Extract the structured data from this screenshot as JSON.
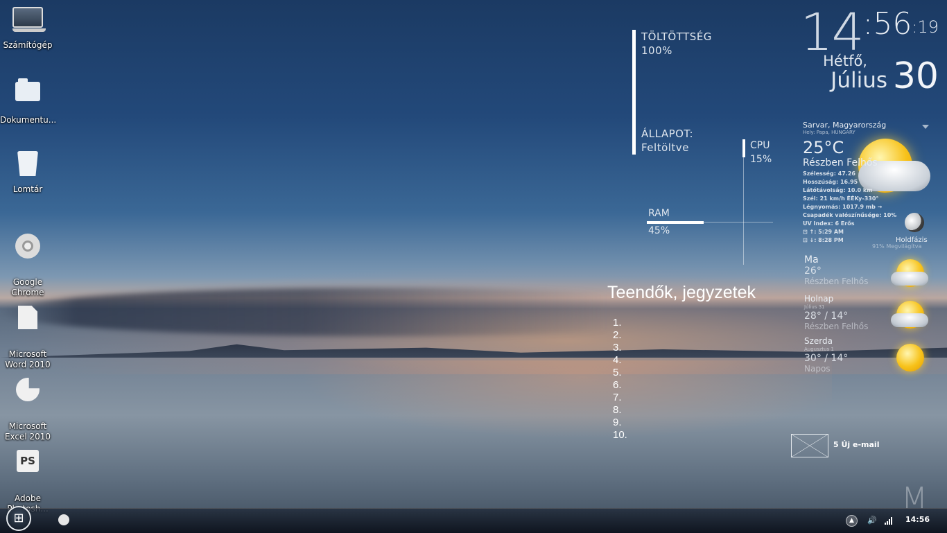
{
  "desktop_icons": [
    {
      "label": "Számítógép",
      "icon": "computer-icon"
    },
    {
      "label": "Dokumentu...",
      "icon": "documents-folder-icon"
    },
    {
      "label": "Lomtár",
      "icon": "recycle-bin-icon"
    },
    {
      "label": "Google\nChrome",
      "icon": "chrome-icon"
    },
    {
      "label": "Microsoft\nWord 2010",
      "icon": "word-icon"
    },
    {
      "label": "Microsoft\nExcel 2010",
      "icon": "excel-icon"
    },
    {
      "label": "Adobe\nPhotosh...",
      "icon": "photoshop-icon"
    }
  ],
  "photoshop_glyph": "PS",
  "clock": {
    "hours": "14",
    "colon": ":",
    "minutes": "56",
    "seconds": ":19",
    "weekday": "Hétfő,",
    "month": "Július",
    "day": "30"
  },
  "battery": {
    "charge_label": "TÖLTÖTTSÉG",
    "charge_value": "100%",
    "state_label": "ÁLLAPOT:",
    "state_value": "Feltöltve"
  },
  "system": {
    "cpu_label": "CPU",
    "cpu_value": "15%",
    "cpu_percent": 15,
    "ram_label": "RAM",
    "ram_value": "45%",
    "ram_percent": 45
  },
  "weather": {
    "location": "Sarvar, Magyarország",
    "station": "Hely: Papa, HUNGARY",
    "temp": "25°C",
    "condition": "Részben Felhős",
    "details": [
      "Szélesség: 47.26",
      "Hosszúság: 16.95",
      "Látótávolság: 10.0 km",
      "Szél: 21 km/h ÉÉKy-330°",
      "Légnyomás: 1017.9 mb →",
      "Csapadék valószínűsége: 10%",
      "UV Index: 6 Erős",
      "⊡ ↑: 5:29 AM",
      "⊡ ↓: 8:28 PM"
    ],
    "moon_label": "Holdfázis",
    "moon_lit": "91% Megvilágítva",
    "forecast": [
      {
        "day": "Ma",
        "date": "",
        "temp": "26°",
        "condition": "Részben Felhős",
        "icon": "sun-cloud-icon"
      },
      {
        "day": "Holnap",
        "date": "Július 31",
        "temp": "28° / 14°",
        "condition": "Részben Felhős",
        "icon": "sun-cloud-icon"
      },
      {
        "day": "Szerda",
        "date": "Augusztus 1",
        "temp": "30° / 14°",
        "condition": "Napos",
        "icon": "sun-icon"
      }
    ]
  },
  "notes": {
    "title": "Teendők, jegyzetek",
    "items": [
      "1.",
      "2.",
      "3.",
      "4.",
      "5.",
      "6.",
      "7.",
      "8.",
      "9.",
      "10."
    ]
  },
  "mail": {
    "label": "5 Új e-mail"
  },
  "logo": "M",
  "taskbar": {
    "time": "14:56"
  }
}
